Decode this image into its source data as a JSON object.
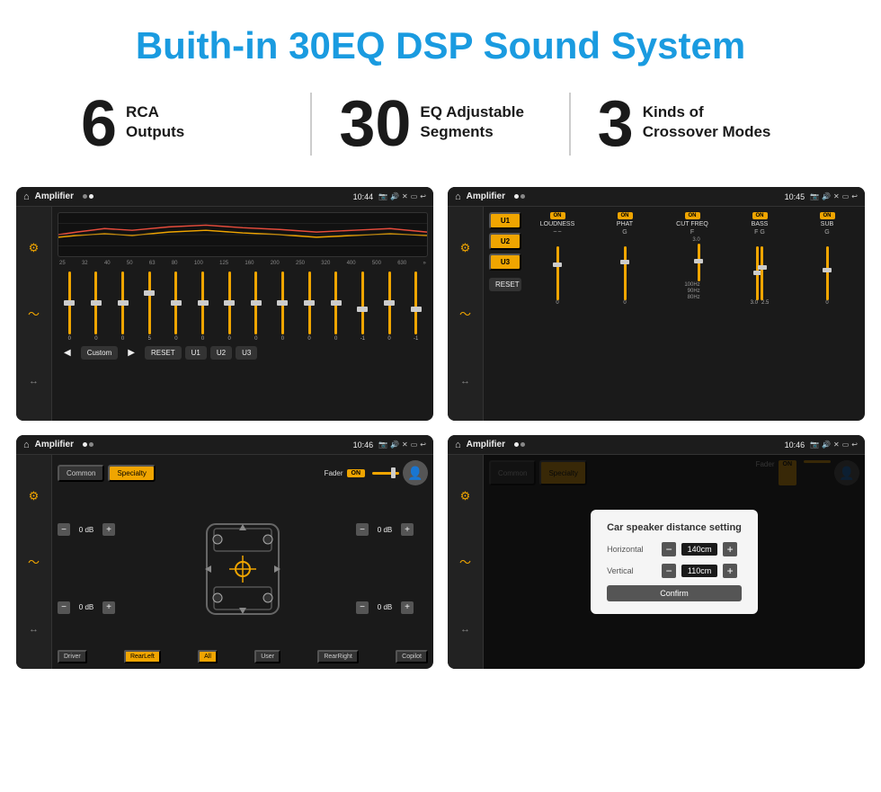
{
  "header": {
    "title": "Buith-in 30EQ DSP Sound System"
  },
  "stats": [
    {
      "number": "6",
      "label": "RCA\nOutputs"
    },
    {
      "number": "30",
      "label": "EQ Adjustable\nSegments"
    },
    {
      "number": "3",
      "label": "Kinds of\nCrossover Modes"
    }
  ],
  "screens": [
    {
      "id": "eq-screen",
      "topbar": {
        "title": "Amplifier",
        "time": "10:44"
      },
      "type": "eq"
    },
    {
      "id": "amp2-screen",
      "topbar": {
        "title": "Amplifier",
        "time": "10:45"
      },
      "type": "amp2",
      "presets": [
        "U1",
        "U2",
        "U3"
      ],
      "channels": [
        "LOUDNESS",
        "PHAT",
        "CUT FREQ",
        "BASS",
        "SUB"
      ],
      "reset_label": "RESET"
    },
    {
      "id": "bal-screen",
      "topbar": {
        "title": "Amplifier",
        "time": "10:46"
      },
      "type": "balance",
      "tabs": [
        "Common",
        "Specialty"
      ],
      "fader_label": "Fader",
      "fader_on": "ON",
      "db_values": [
        "0 dB",
        "0 dB",
        "0 dB",
        "0 dB"
      ],
      "labels": [
        "Driver",
        "RearLeft",
        "All",
        "User",
        "RearRight",
        "Copilot"
      ]
    },
    {
      "id": "dist-screen",
      "topbar": {
        "title": "Amplifier",
        "time": "10:46"
      },
      "type": "distance",
      "dialog": {
        "title": "Car speaker distance setting",
        "horizontal_label": "Horizontal",
        "horizontal_value": "140cm",
        "vertical_label": "Vertical",
        "vertical_value": "110cm",
        "confirm_label": "Confirm"
      }
    }
  ],
  "eq_freq_labels": [
    "25",
    "32",
    "40",
    "50",
    "63",
    "80",
    "100",
    "125",
    "160",
    "200",
    "250",
    "320",
    "400",
    "500",
    "630"
  ],
  "eq_slider_values": [
    "0",
    "0",
    "0",
    "5",
    "0",
    "0",
    "0",
    "0",
    "0",
    "0",
    "0",
    "-1",
    "0",
    "-1"
  ],
  "eq_buttons": [
    "Custom",
    "RESET",
    "U1",
    "U2",
    "U3"
  ]
}
